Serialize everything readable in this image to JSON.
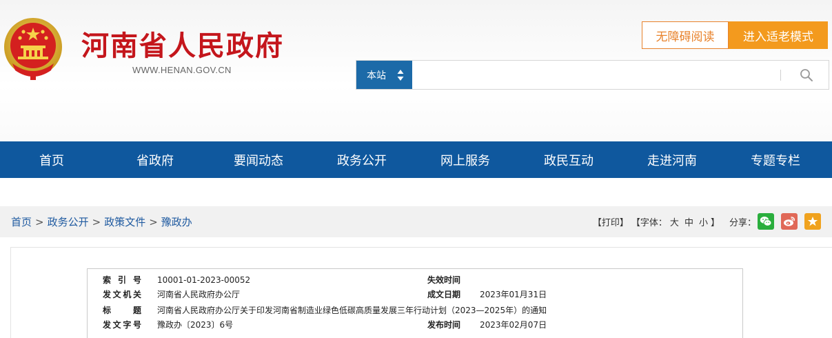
{
  "header": {
    "site_title": "河南省人民政府",
    "site_url": "WWW.HENAN.GOV.CN",
    "accessible_label": "无障碍阅读",
    "elder_mode_label": "进入适老模式"
  },
  "search": {
    "scope": "本站",
    "value": ""
  },
  "nav": {
    "items": [
      "首页",
      "省政府",
      "要闻动态",
      "政务公开",
      "网上服务",
      "政民互动",
      "走进河南",
      "专题专栏"
    ]
  },
  "breadcrumb": {
    "items": [
      "首页",
      "政务公开",
      "政策文件",
      "豫政办"
    ],
    "separator": ">"
  },
  "tools": {
    "print": "【打印】",
    "font_prefix": "【字体：",
    "font_large": "大",
    "font_medium": "中",
    "font_small": "小",
    "font_suffix": "】",
    "share_label": "分享："
  },
  "colors": {
    "brand_red": "#c4161c",
    "nav_blue": "#0f589e",
    "scope_blue": "#1c6aa8",
    "orange": "#f39a1e",
    "wechat_green": "#2aae3d",
    "weibo_red": "#e06857",
    "favorite_orange": "#f0a21e"
  },
  "doc_info": {
    "index_label": "索引号",
    "index_value": "10001-01-2023-00052",
    "expiry_label": "失效时间",
    "expiry_value": "",
    "issuer_label": "发文机关",
    "issuer_value": "河南省人民政府办公厅",
    "created_label": "成文日期",
    "created_value": "2023年01月31日",
    "title_label": "标题",
    "title_value": "河南省人民政府办公厅关于印发河南省制造业绿色低碳高质量发展三年行动计划（2023—2025年）的通知",
    "docno_label": "发文字号",
    "docno_value": "豫政办〔2023〕6号",
    "published_label": "发布时间",
    "published_value": "2023年02月07日"
  }
}
